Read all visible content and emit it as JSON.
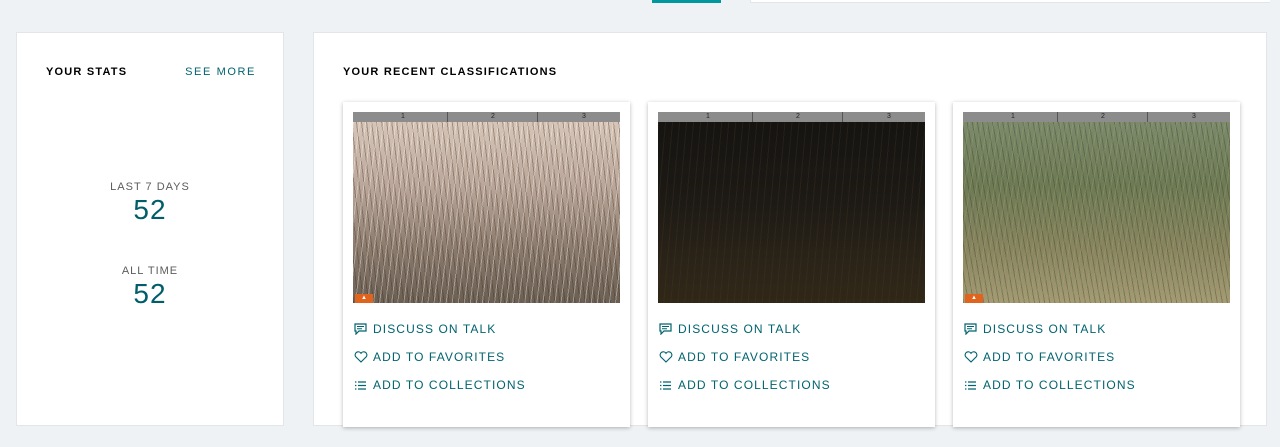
{
  "nav": {
    "active_tab_color": "#00979d"
  },
  "stats": {
    "title": "YOUR STATS",
    "see_more": "SEE MORE",
    "last7_label": "LAST 7 DAYS",
    "last7_value": "52",
    "alltime_label": "ALL TIME",
    "alltime_value": "52"
  },
  "recent": {
    "title": "YOUR RECENT CLASSIFICATIONS",
    "ruler_marks": [
      "1",
      "2",
      "3"
    ],
    "cards": [
      {
        "image": "trail-camera-tall-dry-grass",
        "discuss": "DISCUSS ON TALK",
        "favorite": "ADD TO FAVORITES",
        "collect": "ADD TO COLLECTIONS"
      },
      {
        "image": "trail-camera-dark-night-grass",
        "discuss": "DISCUSS ON TALK",
        "favorite": "ADD TO FAVORITES",
        "collect": "ADD TO COLLECTIONS"
      },
      {
        "image": "trail-camera-green-plants",
        "discuss": "DISCUSS ON TALK",
        "favorite": "ADD TO FAVORITES",
        "collect": "ADD TO COLLECTIONS"
      }
    ]
  },
  "colors": {
    "accent": "#00636f",
    "stat_value": "#005d69",
    "background": "#eff2f5"
  }
}
